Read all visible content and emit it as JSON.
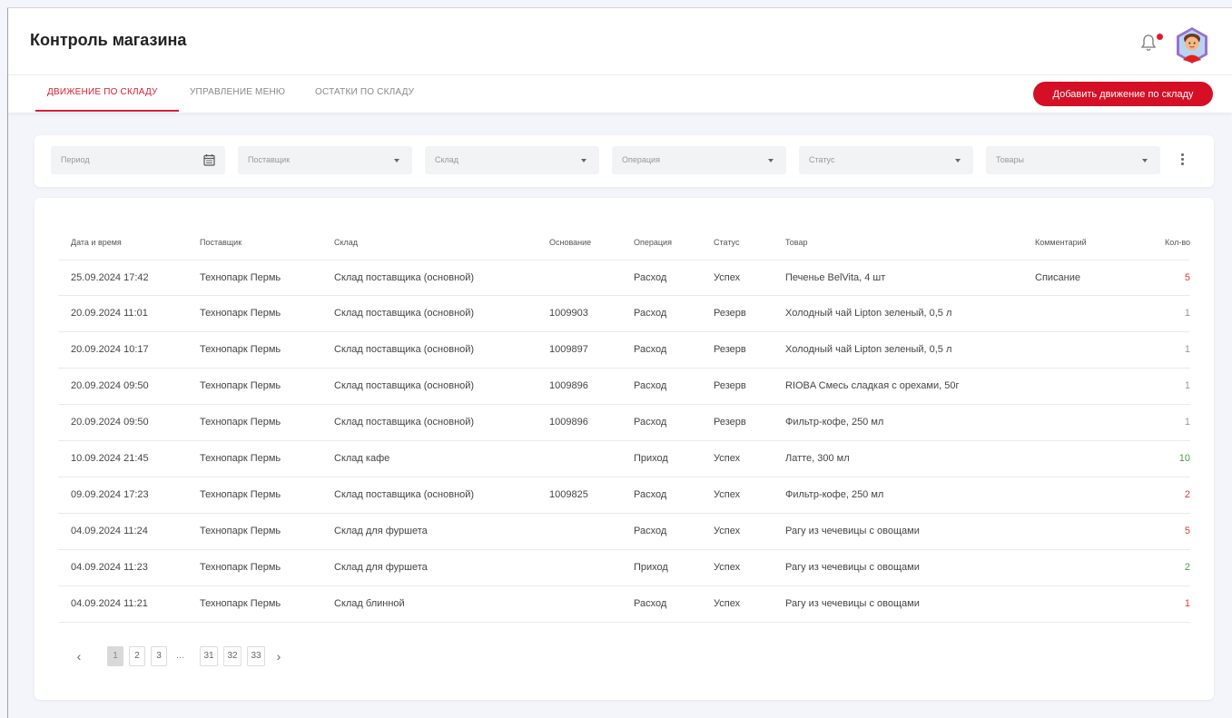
{
  "header": {
    "title": "Контроль магазина"
  },
  "tabs": [
    {
      "label": "Движение по складу",
      "active": true
    },
    {
      "label": "Управление меню",
      "active": false
    },
    {
      "label": "Остатки по складу",
      "active": false
    }
  ],
  "actions": {
    "add_label": "Добавить движение по складу"
  },
  "filters": {
    "period": "Период",
    "supplier": "Поставщик",
    "warehouse": "Склад",
    "operation": "Операция",
    "status": "Статус",
    "goods": "Товары"
  },
  "table": {
    "columns": [
      "Дата и время",
      "Поставщик",
      "Склад",
      "Основание",
      "Операция",
      "Статус",
      "Товар",
      "Комментарий",
      "Кол-во"
    ],
    "rows": [
      {
        "datetime": "25.09.2024 17:42",
        "supplier": "Технопарк Пермь",
        "warehouse": "Склад поставщика (основной)",
        "basis": "",
        "operation": "Расход",
        "status": "Успех",
        "product": "Печенье BelVita, 4 шт",
        "comment": "Списание",
        "qty": "5",
        "qty_color": "#e53935"
      },
      {
        "datetime": "20.09.2024 11:01",
        "supplier": "Технопарк Пермь",
        "warehouse": "Склад поставщика (основной)",
        "basis": "1009903",
        "operation": "Расход",
        "status": "Резерв",
        "product": "Холодный чай Lipton зеленый, 0,5 л",
        "comment": "",
        "qty": "1",
        "qty_color": "#999999"
      },
      {
        "datetime": "20.09.2024 10:17",
        "supplier": "Технопарк Пермь",
        "warehouse": "Склад поставщика (основной)",
        "basis": "1009897",
        "operation": "Расход",
        "status": "Резерв",
        "product": "Холодный чай Lipton зеленый, 0,5 л",
        "comment": "",
        "qty": "1",
        "qty_color": "#999999"
      },
      {
        "datetime": "20.09.2024 09:50",
        "supplier": "Технопарк Пермь",
        "warehouse": "Склад поставщика (основной)",
        "basis": "1009896",
        "operation": "Расход",
        "status": "Резерв",
        "product": "RIOBA Смесь сладкая с орехами, 50г",
        "comment": "",
        "qty": "1",
        "qty_color": "#999999"
      },
      {
        "datetime": "20.09.2024 09:50",
        "supplier": "Технопарк Пермь",
        "warehouse": "Склад поставщика (основной)",
        "basis": "1009896",
        "operation": "Расход",
        "status": "Резерв",
        "product": "Фильтр-кофе, 250 мл",
        "comment": "",
        "qty": "1",
        "qty_color": "#999999"
      },
      {
        "datetime": "10.09.2024 21:45",
        "supplier": "Технопарк Пермь",
        "warehouse": "Склад кафе",
        "basis": "",
        "operation": "Приход",
        "status": "Успех",
        "product": "Латте, 300 мл",
        "comment": "",
        "qty": "10",
        "qty_color": "#43a047"
      },
      {
        "datetime": "09.09.2024 17:23",
        "supplier": "Технопарк Пермь",
        "warehouse": "Склад поставщика (основной)",
        "basis": "1009825",
        "operation": "Расход",
        "status": "Успех",
        "product": "Фильтр-кофе, 250 мл",
        "comment": "",
        "qty": "2",
        "qty_color": "#e53935"
      },
      {
        "datetime": "04.09.2024 11:24",
        "supplier": "Технопарк Пермь",
        "warehouse": "Склад для фуршета",
        "basis": "",
        "operation": "Расход",
        "status": "Успех",
        "product": "Рагу из чечевицы с овощами",
        "comment": "",
        "qty": "5",
        "qty_color": "#e53935"
      },
      {
        "datetime": "04.09.2024 11:23",
        "supplier": "Технопарк Пермь",
        "warehouse": "Склад для фуршета",
        "basis": "",
        "operation": "Приход",
        "status": "Успех",
        "product": "Рагу из чечевицы с овощами",
        "comment": "",
        "qty": "2",
        "qty_color": "#43a047"
      },
      {
        "datetime": "04.09.2024 11:21",
        "supplier": "Технопарк Пермь",
        "warehouse": "Склад блинной",
        "basis": "",
        "operation": "Расход",
        "status": "Успех",
        "product": "Рагу из чечевицы с овощами",
        "comment": "",
        "qty": "1",
        "qty_color": "#e53935"
      }
    ]
  },
  "pagination": {
    "prev": "‹",
    "next": "›",
    "pages": [
      "1",
      "2",
      "3"
    ],
    "ellipsis": "...",
    "last_pages": [
      "31",
      "32",
      "33"
    ],
    "current": "1"
  },
  "colors": {
    "accent": "#d50f25",
    "positive": "#43a047",
    "negative": "#e53935",
    "neutral": "#999999"
  },
  "icons": {
    "notifications": "bell-icon",
    "profile": "avatar-icon",
    "calendar": "calendar-icon",
    "more": "more-vertical-icon",
    "dropdown": "chevron-down-icon"
  }
}
